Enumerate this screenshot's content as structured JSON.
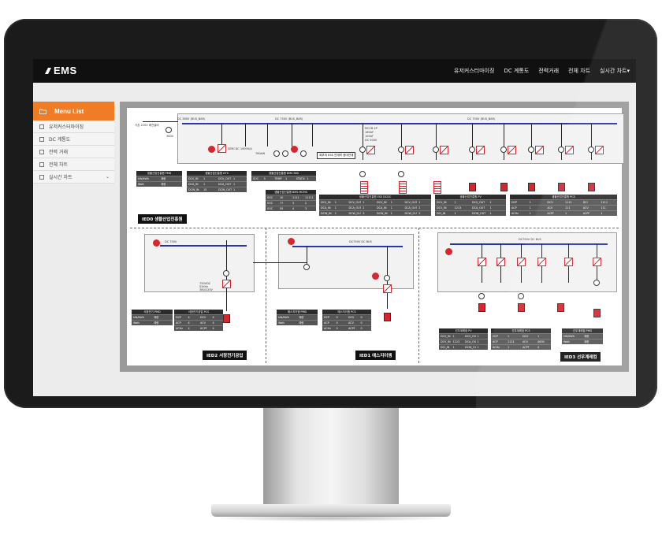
{
  "app": {
    "logo": "EMS"
  },
  "nav": [
    {
      "label": "유저커스터마이징"
    },
    {
      "label": "DC 계통도"
    },
    {
      "label": "전력거래"
    },
    {
      "label": "전체 차트"
    },
    {
      "label": "실시간 차트▾"
    }
  ],
  "sidebar": {
    "title": "Menu List",
    "items": [
      {
        "label": "유저커스터마이징"
      },
      {
        "label": "DC 계통도"
      },
      {
        "label": "전력 거래"
      },
      {
        "label": "전체 차트"
      },
      {
        "label": "실시간 차트",
        "chevron": "⌄"
      }
    ]
  },
  "diagram": {
    "ied0": {
      "label": "IED0 생물산업진흥원",
      "bus_left": "DC 380V (BUS_BAR)",
      "bus_mid": "DC 750V (BUS_BAR)",
      "bus_right": "DC 750V (BUS_BAR)",
      "notice": "외부의 ESS 연계의 광대연계",
      "side_text": "기존 220V 배전설비",
      "ac_label": "380V",
      "converter_label": "SEMI DC 1000V/A",
      "breaker_label": "MCCB",
      "spec_lines": [
        "MCCB 4P",
        "160AF",
        "100AT",
        "DC 500V"
      ],
      "values": [
        "760kW",
        "Vdc/S"
      ]
    },
    "ied1": {
      "label": "IED1 에스지이엠",
      "bus": "DC750V DC BUS"
    },
    "ied2": {
      "label": "IED2 서창전기공업",
      "bus": "DC 750V",
      "spec": "750VDC 52kHz 380/220V"
    },
    "ied3": {
      "label": "IED3 선우계레컴",
      "bus": "DC750V DC BUS"
    },
    "tables": {
      "pmd0": {
        "title": "생물산업진흥원 PMD",
        "rows": [
          [
            "kW/kWh",
            "",
            "계량"
          ],
          [
            "Watt",
            "",
            "계량"
          ]
        ]
      },
      "dcdc0": {
        "title": "생물산업진흥원 DTS",
        "rows": [
          [
            "DCV_IN",
            "1",
            "DCV_OUT",
            "1"
          ],
          [
            "DCA_IN",
            "1",
            "DCA_OUT",
            "1"
          ],
          [
            "DCW_IN",
            "15",
            "DCW_OUT",
            "1"
          ]
        ]
      },
      "bms": {
        "title": "생물산업진흥원 BMS SBS",
        "rows": [
          [
            "SOC",
            "5",
            "TEMP",
            "1",
            "STATUS",
            "1"
          ]
        ]
      },
      "bms2": {
        "title": "생물산업진흥원 BMS MCMS",
        "rows": [
          [
            "SOC",
            "10",
            "TEMP",
            "1111",
            "STATUS",
            "11111"
          ],
          [
            "SOC",
            "77",
            "TEMP",
            "3",
            "STATUS",
            "2"
          ],
          [
            "SOC",
            "55",
            "TEMP",
            "4",
            "STATUS",
            "3"
          ]
        ]
      },
      "ess": {
        "title": "생물산업진흥원 ESS DCDC",
        "rows": [
          [
            "DCV_IN",
            "1",
            "DCV_OUT",
            "1",
            "DCV_IN",
            "1",
            "DCV_OUT",
            "1"
          ],
          [
            "DCA_IN",
            "1",
            "DCA_OUT",
            "2",
            "DCA_IN",
            "1",
            "DCA_OUT",
            "2"
          ],
          [
            "DCW_IN",
            "1",
            "DCW_OUT",
            "3",
            "DCW_IN",
            "1",
            "DCW_OUT",
            "3"
          ]
        ]
      },
      "pv": {
        "title": "생물산업진흥원 PV",
        "rows": [
          [
            "DCV_IN",
            "1",
            "DCV_OUT",
            "1"
          ],
          [
            "DCV_IN",
            "1213",
            "DCA_OUT",
            "1"
          ],
          [
            "DCI_IN",
            "1",
            "DCW_OUT",
            "1"
          ]
        ]
      },
      "pcs": {
        "title": "생물산업진흥원 PCS",
        "rows": [
          [
            "DCP",
            "1",
            "DCV",
            "1111",
            "DCI",
            "1111",
            "DCI",
            "1111"
          ],
          [
            "ACP",
            "1",
            "ACV",
            "111",
            "ACV",
            "111",
            "ACI",
            "111"
          ],
          [
            "ACHz",
            "1",
            "ACPF",
            "1",
            "ACPF",
            "1",
            "ACW",
            "1"
          ]
        ]
      },
      "pmd2": {
        "title": "서창전기 PMD",
        "rows": [
          [
            "kW/kWh",
            "",
            "계량"
          ],
          [
            "Watt",
            "",
            "계량"
          ]
        ]
      },
      "pcs2": {
        "title": "서창전기공업 PCS",
        "rows": [
          [
            "DCP",
            "4",
            "DCV",
            "4",
            "DCI",
            "4"
          ],
          [
            "ACP",
            "4",
            "ACV",
            "4",
            "ACI",
            "4"
          ],
          [
            "ACHz",
            "4",
            "ACPF",
            "4",
            "ACW",
            "4"
          ]
        ]
      },
      "pmd1": {
        "title": "에스지이엠 PMD",
        "rows": [
          [
            "kW/kWh",
            "",
            "계량"
          ],
          [
            "Watt",
            "",
            "계량"
          ]
        ]
      },
      "pcs1": {
        "title": "에스지이엠 PCS",
        "rows": [
          [
            "DCP",
            "0",
            "DCV",
            "0",
            "DCI",
            "0"
          ],
          [
            "ACP",
            "0",
            "ACV",
            "0",
            "ACI",
            "0"
          ],
          [
            "ACHz",
            "0",
            "ACPF",
            "0",
            "ACW",
            "0"
          ]
        ]
      },
      "pv3": {
        "title": "선우계레컴 PV",
        "rows": [
          [
            "DCV_IN",
            "1",
            "DCV_OUT",
            "1"
          ],
          [
            "DCV_IN",
            "1213",
            "DCA_OUT",
            "1"
          ],
          [
            "DCI_IN",
            "1",
            "DCW_OUT",
            "1"
          ]
        ]
      },
      "pcs3": {
        "title": "선우계레컴 PCS",
        "rows": [
          [
            "DCP",
            "1",
            "DCV",
            "1",
            "DCI",
            "1"
          ],
          [
            "ACP",
            "1111",
            "ACV",
            "4000",
            "ACI",
            "1"
          ],
          [
            "ACHz",
            "1",
            "ACPF",
            "4",
            "ACW",
            "4"
          ]
        ]
      },
      "pmd3": {
        "title": "선우계레컴 PMD",
        "rows": [
          [
            "kW/kWh",
            "",
            "계량"
          ],
          [
            "Watt",
            "",
            "계량"
          ]
        ]
      }
    }
  },
  "colors": {
    "accent": "#f07c25",
    "bus": "#2a35a8",
    "alarm": "#d8262e",
    "header": "#101010"
  }
}
